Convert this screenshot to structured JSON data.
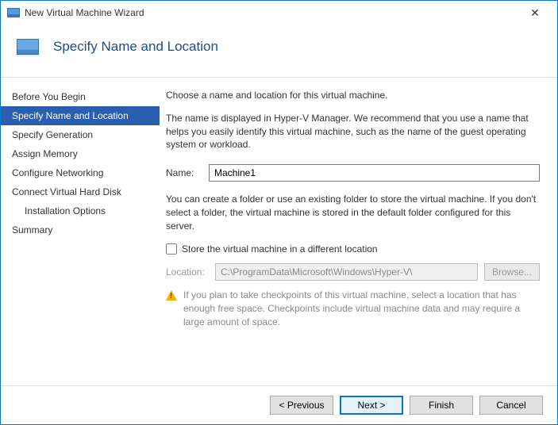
{
  "window": {
    "title": "New Virtual Machine Wizard"
  },
  "header": {
    "title": "Specify Name and Location"
  },
  "sidebar": {
    "items": [
      {
        "label": "Before You Begin",
        "active": false
      },
      {
        "label": "Specify Name and Location",
        "active": true
      },
      {
        "label": "Specify Generation",
        "active": false
      },
      {
        "label": "Assign Memory",
        "active": false
      },
      {
        "label": "Configure Networking",
        "active": false
      },
      {
        "label": "Connect Virtual Hard Disk",
        "active": false
      },
      {
        "label": "Installation Options",
        "active": false,
        "indent": true
      },
      {
        "label": "Summary",
        "active": false
      }
    ]
  },
  "content": {
    "intro": "Choose a name and location for this virtual machine.",
    "desc": "The name is displayed in Hyper-V Manager. We recommend that you use a name that helps you easily identify this virtual machine, such as the name of the guest operating system or workload.",
    "name_label": "Name:",
    "name_value": "Machine1",
    "folder_desc": "You can create a folder or use an existing folder to store the virtual machine. If you don't select a folder, the virtual machine is stored in the default folder configured for this server.",
    "store_checkbox_label": "Store the virtual machine in a different location",
    "location_label": "Location:",
    "location_value": "C:\\ProgramData\\Microsoft\\Windows\\Hyper-V\\",
    "browse_label": "Browse...",
    "warning": "If you plan to take checkpoints of this virtual machine, select a location that has enough free space. Checkpoints include virtual machine data and may require a large amount of space."
  },
  "footer": {
    "previous": "< Previous",
    "next": "Next >",
    "finish": "Finish",
    "cancel": "Cancel"
  }
}
